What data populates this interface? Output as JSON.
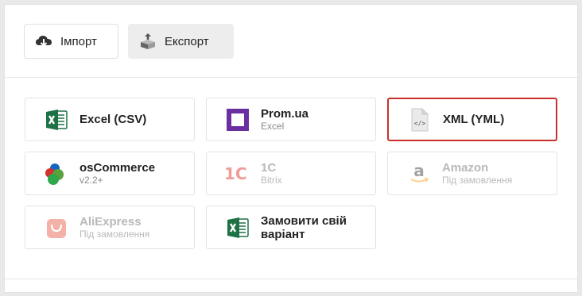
{
  "tabs": {
    "import_label": "Імпорт",
    "export_label": "Експорт",
    "import_icon": "cloud-download-icon",
    "export_icon": "box-upload-icon"
  },
  "cards": [
    {
      "title": "Excel (CSV)",
      "sub": "",
      "icon": "excel-icon",
      "state": "enabled"
    },
    {
      "title": "Prom.ua",
      "sub": "Excel",
      "icon": "prom-icon",
      "state": "enabled"
    },
    {
      "title": "XML (YML)",
      "sub": "",
      "icon": "xml-file-icon",
      "state": "selected"
    },
    {
      "title": "osCommerce",
      "sub": "v2.2+",
      "icon": "oscommerce-icon",
      "state": "enabled"
    },
    {
      "title": "1C",
      "sub": "Bitrix",
      "icon": "1c-icon",
      "state": "disabled"
    },
    {
      "title": "Amazon",
      "sub": "Під замовлення",
      "icon": "amazon-icon",
      "state": "disabled"
    },
    {
      "title": "AliExpress",
      "sub": "Під замовлення",
      "icon": "aliexpress-icon",
      "state": "disabled"
    },
    {
      "title": "Замовити свій варіант",
      "sub": "",
      "icon": "excel-icon",
      "state": "enabled"
    }
  ],
  "colors": {
    "excel_green": "#1e7145",
    "prom_purple": "#6a2fa0",
    "selected_border": "#c9302c",
    "aliexpress_red": "#e8543d",
    "onec_red": "#e2231a",
    "amazon_orange": "#ff9900"
  }
}
